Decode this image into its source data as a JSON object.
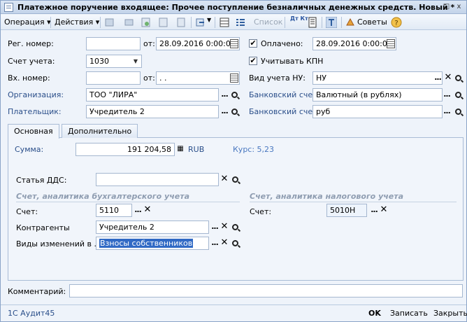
{
  "window": {
    "title": "Платежное поручение входящее: Прочее поступление безналичных денежных средств. Новый *",
    "controls": [
      "...",
      "□",
      "x"
    ]
  },
  "toolbar": {
    "operation": "Операция ▾",
    "actions": "Действия ▾",
    "list": "Список",
    "advice": "Советы",
    "dt_kt": "Дт Кт"
  },
  "header": {
    "reg_number_label": "Рег. номер:",
    "reg_number_value": "",
    "from_label": "от:",
    "reg_date": "28.09.2016  0:00:00",
    "paid_label": "Оплачено:",
    "paid_date": "28.09.2016  0:00:00",
    "paid_checked": "✔",
    "account_label": "Счет учета:",
    "account_value": "1030",
    "kpn_label": "Учитывать КПН",
    "kpn_checked": "✔",
    "in_number_label": "Вх. номер:",
    "in_number_value": "",
    "in_from_label": "от:",
    "in_date": " .  .",
    "nu_label": "Вид учета НУ:",
    "nu_value": "НУ",
    "org_label": "Организация:",
    "org_value": "ТОО \"ЛИРА\"",
    "bank_label_1": "Банковский счет:",
    "bank_value_1": "Валютный (в рублях)",
    "payer_label": "Плательщик:",
    "payer_value": "Учредитель 2",
    "bank_label_2": "Банковский счет:",
    "bank_value_2": "руб"
  },
  "tabs": {
    "main": "Основная",
    "extra": "Дополнительно"
  },
  "main": {
    "sum_label": "Сумма:",
    "sum_value": "191 204,58",
    "currency": "RUB",
    "rate": "Курс: 5,23",
    "dds_label": "Статья ДДС:",
    "dds_value": "",
    "accounting_section": "Счет, аналитика бухгалтерского учета",
    "tax_section": "Счет, аналитика налогового учета",
    "acc_label": "Счет:",
    "acc_value": "5110",
    "tax_acc_label": "Счет:",
    "tax_acc_value": "5010Н",
    "contr_label": "Контрагенты",
    "contr_value": "Учредитель 2",
    "changes_label": "Виды изменений в ...",
    "changes_value": "Взносы собственников"
  },
  "comment": {
    "label": "Комментарий:",
    "value": ""
  },
  "status": {
    "app": "1С Аудит45",
    "ok": "OK",
    "save": "Записать",
    "close": "Закрыть"
  },
  "colors": {
    "accent": "#2b4f8a",
    "window_bg": "#eef3fa",
    "border": "#a5b7d0"
  }
}
